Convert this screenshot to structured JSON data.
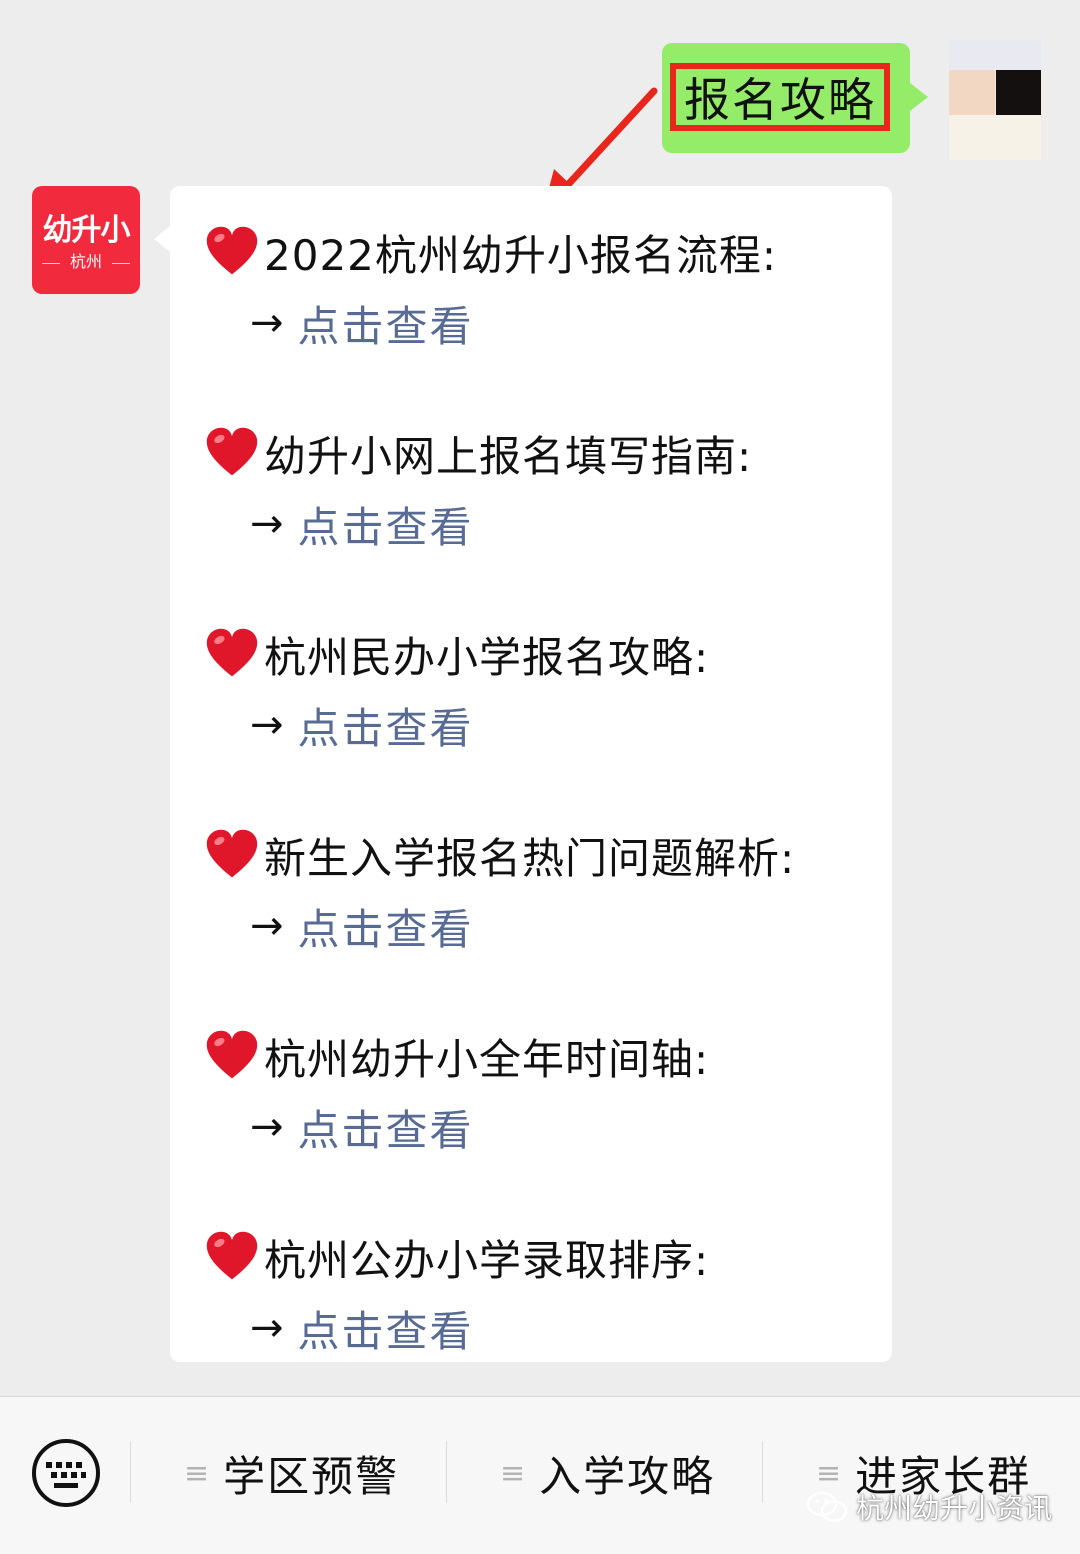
{
  "sent_message": {
    "text": "报名攻略"
  },
  "official_account": {
    "avatar_main": "幼升小",
    "avatar_sub": "杭州"
  },
  "reply": {
    "link_arrow": "→",
    "items": [
      {
        "title": "2022杭州幼升小报名流程:",
        "link": "点击查看"
      },
      {
        "title": "幼升小网上报名填写指南:",
        "link": "点击查看"
      },
      {
        "title": "杭州民办小学报名攻略:",
        "link": "点击查看"
      },
      {
        "title": "新生入学报名热门问题解析:",
        "link": "点击查看"
      },
      {
        "title": "杭州幼升小全年时间轴:",
        "link": "点击查看"
      },
      {
        "title": "杭州公办小学录取排序:",
        "link": "点击查看"
      }
    ]
  },
  "menu": {
    "items": [
      {
        "label": "学区预警",
        "icon": "menu-lines-icon"
      },
      {
        "label": "入学攻略",
        "icon": "menu-lines-icon"
      },
      {
        "label": "进家长群",
        "icon": "menu-lines-icon"
      }
    ]
  },
  "watermark": {
    "text": "杭州幼升小资讯",
    "icon": "wechat-icon"
  },
  "colors": {
    "sent_bubble": "#95ec69",
    "highlight_border": "#e8261c",
    "link": "#576b95",
    "avatar_red": "#f12a3d",
    "heart": "#e0162b"
  }
}
